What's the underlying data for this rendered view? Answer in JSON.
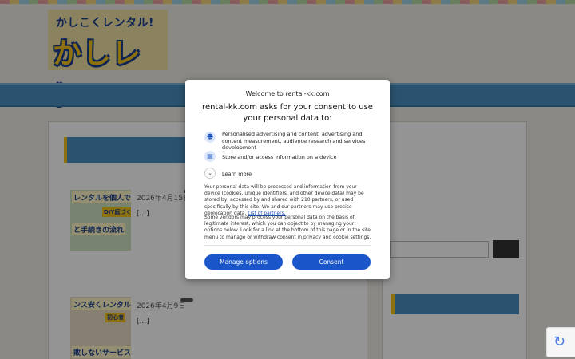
{
  "logo": {
    "top_text": "かしこくレンタル!",
    "main_text": "かしレン"
  },
  "nav": {
    "items": [
      "",
      "",
      ""
    ]
  },
  "main": {
    "section_title": "",
    "articles": [
      {
        "link": "",
        "thumb_text": "レンタルを個人です",
        "thumb_text2": "と手続きの流れ",
        "thumb_badge": "DIY庭づくり",
        "date": "2026年4月15日",
        "tag": "",
        "excerpt": "",
        "excerpt_tail": "[...]"
      },
      {
        "link": "",
        "thumb_text": "ンス安くレンタルす",
        "thumb_text2": "敗しないサービス選びの",
        "thumb_badge": "初心者",
        "date": "2026年4月9日",
        "tag": "",
        "excerpt": "",
        "excerpt_tail": "[...]"
      }
    ],
    "more_link": ""
  },
  "sidebar": {
    "search_label": "",
    "search_placeholder": "",
    "search_button": "",
    "section_title": "",
    "links": [
      "",
      "",
      ""
    ]
  },
  "consent": {
    "welcome": "Welcome to rental-kk.com",
    "heading": "rental-kk.com asks for your consent to use your personal data to:",
    "rows": [
      {
        "icon": "person-icon",
        "text": "Personalised advertising and content, advertising and content measurement, audience research and services development"
      },
      {
        "icon": "device-icon",
        "text": "Store and/or access information on a device"
      }
    ],
    "learn_more": "Learn more",
    "paragraph1": "Your personal data will be processed and information from your device (cookies, unique identifiers, and other device data) may be stored by, accessed by and shared with 210 partners, or used specifically by this site. We and our partners may use precise geolocation data.",
    "partners_link": "List of partners.",
    "paragraph2": "Some vendors may process your personal data on the basis of legitimate interest, which you can object to by managing your options below. Look for a link at the bottom of this page or in the site menu to manage or withdraw consent in privacy and cookie settings.",
    "manage_button": "Manage options",
    "consent_button": "Consent"
  },
  "colors": {
    "accent": "#1a56c9",
    "nav": "#4a8fbf",
    "logo_yellow": "#f3c21c",
    "logo_navy": "#1b3f8e"
  }
}
